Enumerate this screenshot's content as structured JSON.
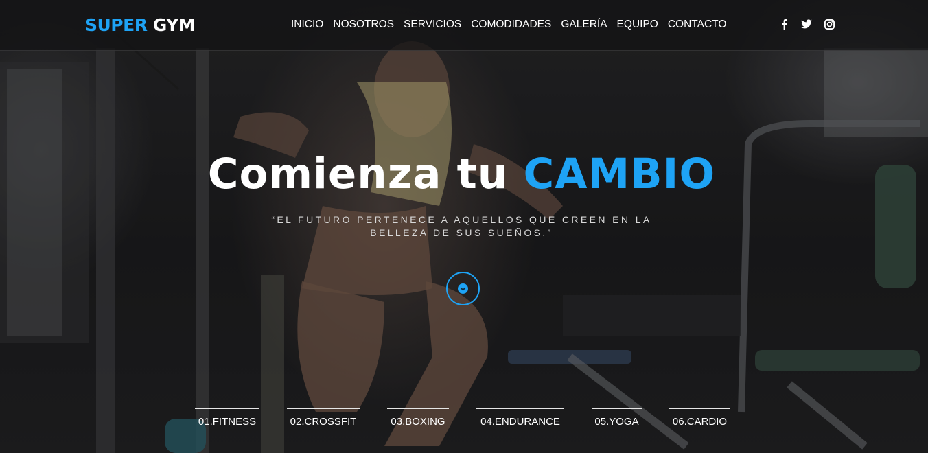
{
  "brand": {
    "logo_accent": "SUPER",
    "logo_rest": "GYM",
    "accent_color": "#1ea3f5"
  },
  "nav": {
    "items": [
      {
        "label": "INICIO"
      },
      {
        "label": "NOSOTROS"
      },
      {
        "label": "SERVICIOS"
      },
      {
        "label": "COMODIDADES"
      },
      {
        "label": "GALERÍA"
      },
      {
        "label": "EQUIPO"
      },
      {
        "label": "CONTACTO"
      }
    ]
  },
  "social": {
    "icons": [
      "facebook-icon",
      "twitter-icon",
      "instagram-icon"
    ]
  },
  "hero": {
    "headline_lead": "Comienza tu",
    "headline_accent": "CAMBIO",
    "quote": "“EL FUTURO PERTENECE A AQUELLOS QUE CREEN EN LA BELLEZA DE SUS SUEÑOS.”",
    "scroll_icon": "chevron-down-icon"
  },
  "categories": [
    {
      "label": "01.FITNESS"
    },
    {
      "label": "02.CROSSFIT"
    },
    {
      "label": "03.BOXING"
    },
    {
      "label": "04.ENDURANCE"
    },
    {
      "label": "05.YOGA"
    },
    {
      "label": "06.CARDIO"
    }
  ]
}
